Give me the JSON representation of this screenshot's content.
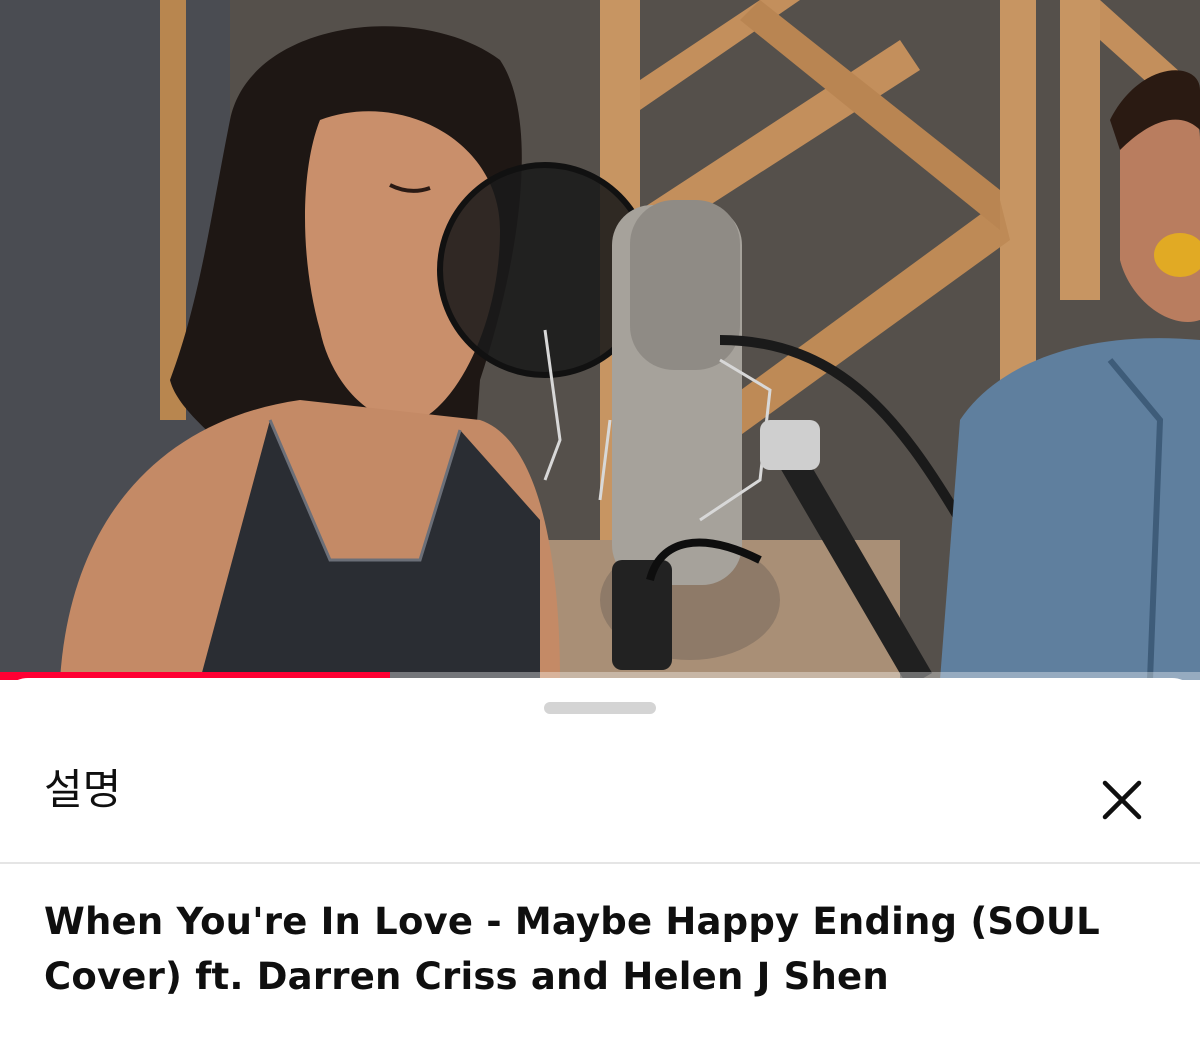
{
  "player": {
    "progress_fraction": 0.325,
    "progress_color": "#ff0033"
  },
  "description_panel": {
    "title": "설명",
    "close_icon": "close-icon",
    "video_title": "When You're In Love - Maybe Happy Ending (SOUL Cover) ft. Darren Criss and Helen J Shen"
  }
}
